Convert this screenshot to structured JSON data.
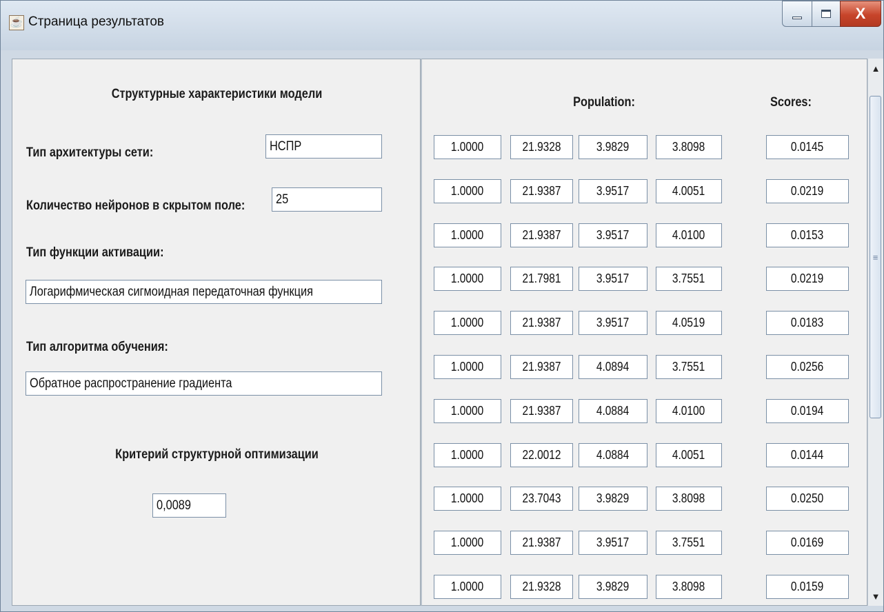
{
  "window": {
    "title": "Страница результатов"
  },
  "left": {
    "structure_title": "Структурные характеристики модели",
    "arch_label": "Тип архитектуры сети:",
    "arch_value": "НСПР",
    "neurons_label": "Количество нейронов в скрытом поле:",
    "neurons_value": "25",
    "activation_label": "Тип функции активации:",
    "activation_value": "Логарифмическая сигмоидная передаточная функция",
    "algorithm_label": "Тип алгоритма обучения:",
    "algorithm_value": "Обратное распространение градиента",
    "criterion_label": "Критерий структурной оптимизации",
    "criterion_value": "0,0089"
  },
  "right": {
    "population_header": "Population:",
    "scores_header": "Scores:",
    "rows": [
      {
        "p": [
          "1.0000",
          "21.9328",
          "3.9829",
          "3.8098"
        ],
        "score": "0.0145"
      },
      {
        "p": [
          "1.0000",
          "21.9387",
          "3.9517",
          "4.0051"
        ],
        "score": "0.0219"
      },
      {
        "p": [
          "1.0000",
          "21.9387",
          "3.9517",
          "4.0100"
        ],
        "score": "0.0153"
      },
      {
        "p": [
          "1.0000",
          "21.7981",
          "3.9517",
          "3.7551"
        ],
        "score": "0.0219"
      },
      {
        "p": [
          "1.0000",
          "21.9387",
          "3.9517",
          "4.0519"
        ],
        "score": "0.0183"
      },
      {
        "p": [
          "1.0000",
          "21.9387",
          "4.0894",
          "3.7551"
        ],
        "score": "0.0256"
      },
      {
        "p": [
          "1.0000",
          "21.9387",
          "4.0884",
          "4.0100"
        ],
        "score": "0.0194"
      },
      {
        "p": [
          "1.0000",
          "22.0012",
          "4.0884",
          "4.0051"
        ],
        "score": "0.0144"
      },
      {
        "p": [
          "1.0000",
          "23.7043",
          "3.9829",
          "3.8098"
        ],
        "score": "0.0250"
      },
      {
        "p": [
          "1.0000",
          "21.9387",
          "3.9517",
          "3.7551"
        ],
        "score": "0.0169"
      },
      {
        "p": [
          "1.0000",
          "21.9328",
          "3.9829",
          "3.8098"
        ],
        "score": "0.0159"
      }
    ]
  },
  "icons": {
    "app": "java-cup-icon",
    "minimize": "minimize-icon",
    "maximize": "maximize-icon",
    "close": "close-icon",
    "scroll_up": "arrow-up-icon",
    "scroll_down": "arrow-down-icon"
  }
}
